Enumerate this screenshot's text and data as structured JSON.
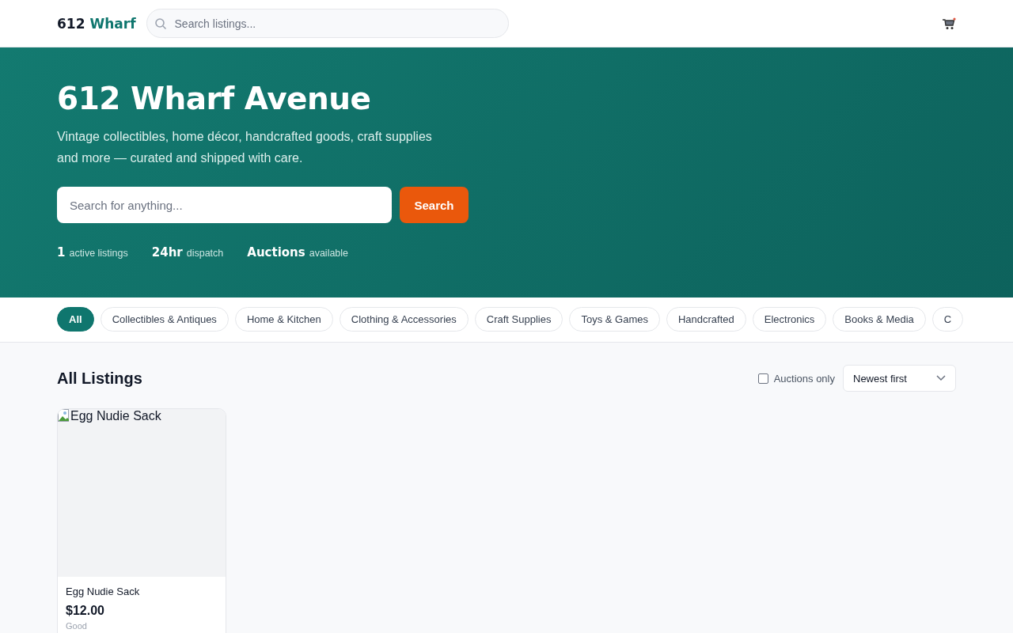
{
  "header": {
    "logo_prefix": "612",
    "logo_name": "Wharf",
    "search": {
      "placeholder": "Search listings..."
    }
  },
  "hero": {
    "title": "612 Wharf Avenue",
    "subtitle": "Vintage collectibles, home décor, handcrafted goods, craft supplies and more — curated and shipped with care.",
    "search": {
      "placeholder": "Search for anything..."
    },
    "search_button": "Search",
    "stats": [
      {
        "value": "1",
        "label": "active listings"
      },
      {
        "value": "24hr",
        "label": "dispatch"
      },
      {
        "value": "Auctions",
        "label": "available"
      }
    ]
  },
  "categories": [
    {
      "label": "All",
      "selected": true
    },
    {
      "label": "Collectibles & Antiques",
      "selected": false
    },
    {
      "label": "Home & Kitchen",
      "selected": false
    },
    {
      "label": "Clothing & Accessories",
      "selected": false
    },
    {
      "label": "Craft Supplies",
      "selected": false
    },
    {
      "label": "Toys & Games",
      "selected": false
    },
    {
      "label": "Handcrafted",
      "selected": false
    },
    {
      "label": "Electronics",
      "selected": false
    },
    {
      "label": "Books & Media",
      "selected": false
    },
    {
      "label": "C",
      "selected": false
    }
  ],
  "listings": {
    "title": "All Listings",
    "auctions_only": {
      "label": "Auctions only",
      "checked": false
    },
    "sort": "Newest first",
    "items": [
      {
        "image_alt": "Egg Nudie Sack",
        "name": "Egg Nudie Sack",
        "price": "$12.00",
        "condition": "Good"
      }
    ]
  }
}
